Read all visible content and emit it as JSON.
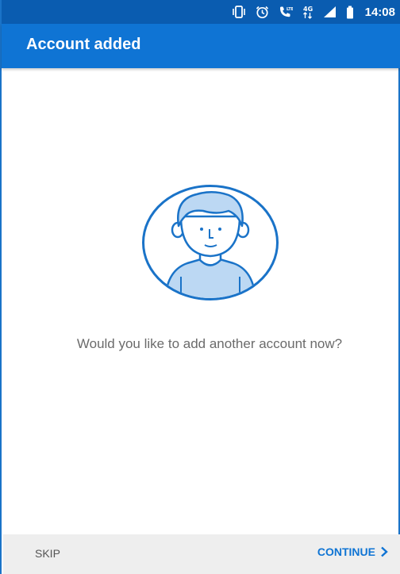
{
  "status_bar": {
    "time": "14:08",
    "icons": [
      "vibrate-icon",
      "alarm-icon",
      "volte-call-icon",
      "4g-data-icon",
      "signal-icon",
      "battery-icon"
    ]
  },
  "app_bar": {
    "title": "Account added"
  },
  "main": {
    "illustration": "person-avatar-icon",
    "prompt": "Would you like to add another account now?"
  },
  "footer": {
    "skip_label": "SKIP",
    "continue_label": "CONTINUE"
  },
  "colors": {
    "status_bar": "#0a5cb0",
    "app_bar": "#0f74d4",
    "accent": "#0f74d4",
    "prompt_text": "#6b6b6b",
    "footer_bg": "#eeeeee"
  }
}
